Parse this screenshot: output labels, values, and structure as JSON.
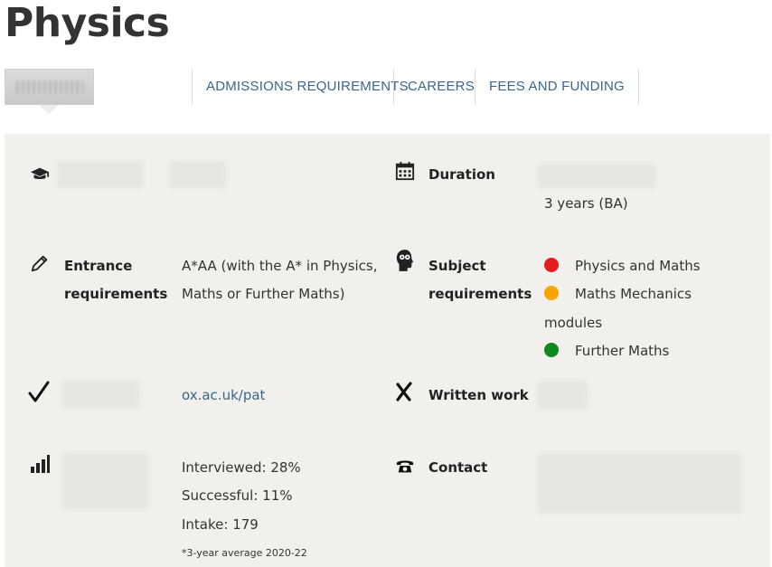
{
  "page": {
    "title": "Physics"
  },
  "tabs": [
    {
      "label": "ADMISSIONS REQUIREMENTS"
    },
    {
      "label": "CAREERS"
    },
    {
      "label": "FEES AND FUNDING"
    }
  ],
  "overview": {
    "duration": {
      "label": "Duration",
      "value": "3 years (BA)"
    },
    "entrance": {
      "label_line1": "Entrance",
      "label_line2": "requirements",
      "value_line1": "A*AA (with the A* in Physics,",
      "value_line2": "Maths or Further Maths)"
    },
    "subject": {
      "label_line1": "Subject",
      "label_line2": "requirements",
      "items": [
        {
          "text": "Physics and Maths",
          "color": "#e81c1c"
        },
        {
          "text": "Maths Mechanics",
          "color": "#f5a400"
        },
        {
          "text": "Further Maths",
          "color": "#0f8a1e"
        }
      ],
      "continuation": "modules"
    },
    "test": {
      "link": "ox.ac.uk/pat"
    },
    "written_work": {
      "label": "Written work"
    },
    "stats": {
      "interviewed": "Interviewed: 28%",
      "successful": "Successful: 11%",
      "intake": "Intake: 179",
      "note": "*3-year average 2020-22"
    },
    "contact": {
      "label": "Contact"
    }
  },
  "colors": {
    "link": "#3a6689",
    "panel": "#f1f0ec"
  }
}
